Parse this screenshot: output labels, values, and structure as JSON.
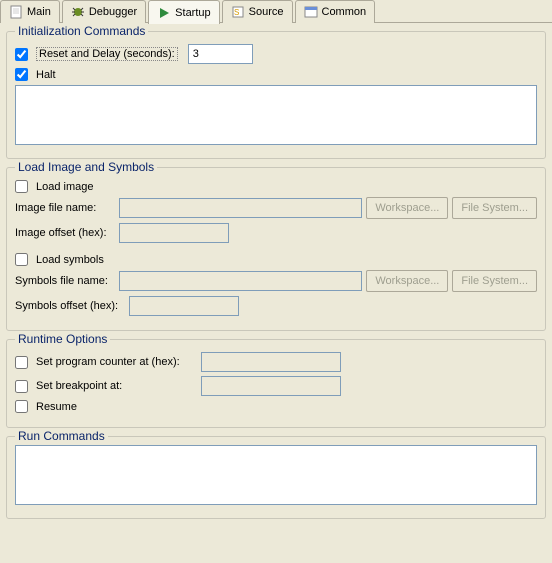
{
  "tabs": {
    "main": "Main",
    "debugger": "Debugger",
    "startup": "Startup",
    "source": "Source",
    "common": "Common"
  },
  "init": {
    "title": "Initialization Commands",
    "reset_label": "Reset and Delay (seconds):",
    "reset_value": "3",
    "halt_label": "Halt"
  },
  "load": {
    "title": "Load Image and Symbols",
    "image_label": "Load image",
    "image_file_label": "Image file name:",
    "image_offset_label": "Image offset (hex):",
    "symbols_label": "Load symbols",
    "symbols_file_label": "Symbols file name:",
    "symbols_offset_label": "Symbols offset (hex):"
  },
  "runtime": {
    "title": "Runtime Options",
    "pc_label": "Set program counter at (hex):",
    "bp_label": "Set breakpoint at:",
    "resume_label": "Resume"
  },
  "run": {
    "title": "Run Commands"
  },
  "buttons": {
    "workspace": "Workspace...",
    "filesystem": "File System..."
  }
}
